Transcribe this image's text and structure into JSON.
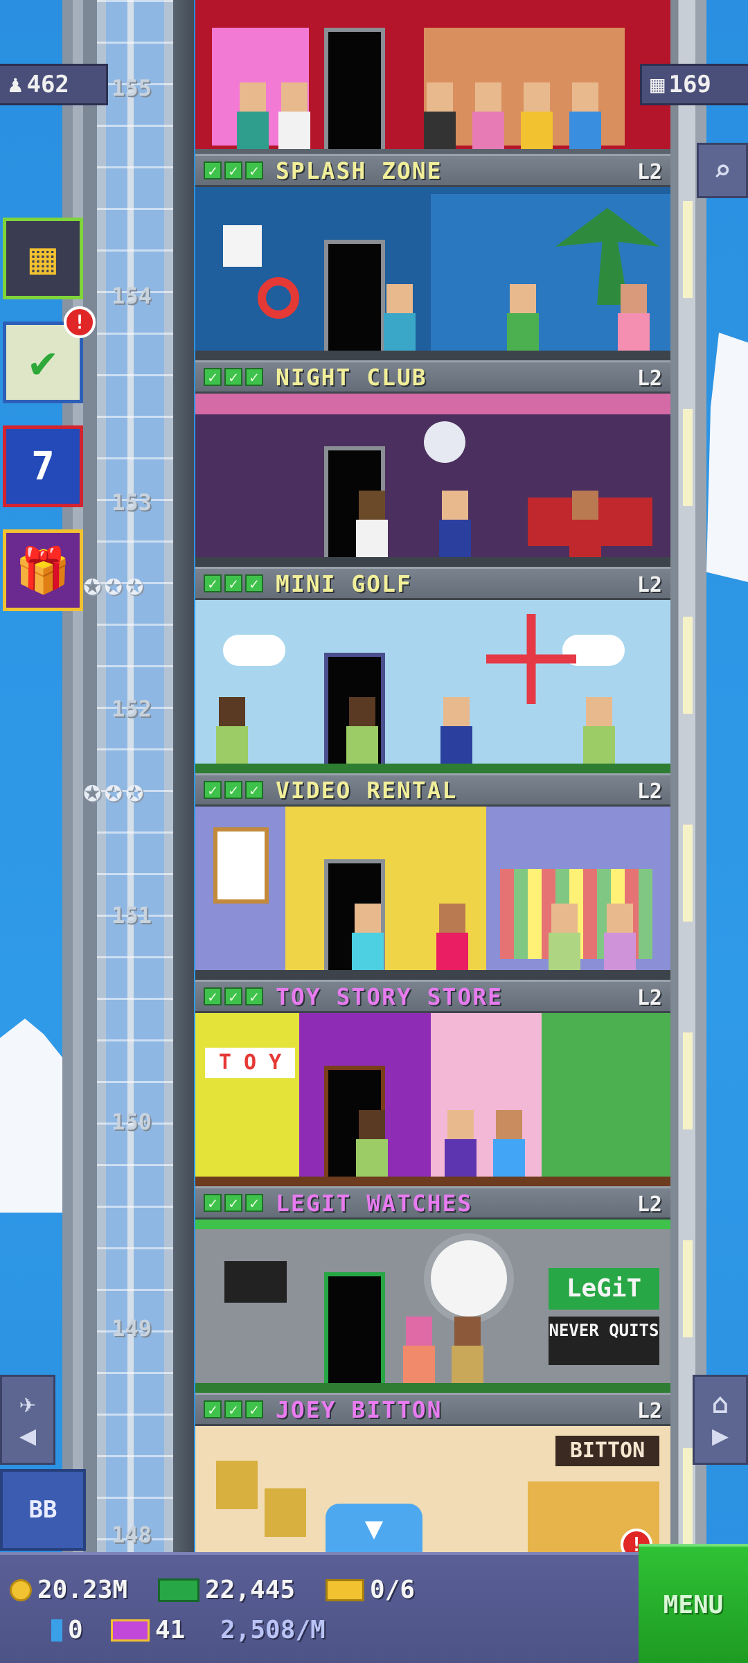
{
  "hud": {
    "population": "462",
    "floors_count": "169",
    "bb_label": "BB"
  },
  "floors": [
    {
      "number": "155",
      "name": "",
      "level": "",
      "theme": "#c83a56"
    },
    {
      "number": "154",
      "name": "SPLASH ZONE",
      "level": "L2",
      "name_color": "#f2ef9a",
      "theme": "#1f5f9e"
    },
    {
      "number": "153",
      "name": "NIGHT CLUB",
      "level": "L2",
      "name_color": "#f2ef9a",
      "theme": "#4b2f5e"
    },
    {
      "number": "152",
      "name": "MINI GOLF",
      "level": "L2",
      "name_color": "#f2ef9a",
      "theme": "#a9d6ee"
    },
    {
      "number": "151",
      "name": "VIDEO RENTAL",
      "level": "L2",
      "name_color": "#f2ef9a",
      "theme": "#f0d447"
    },
    {
      "number": "150",
      "name": "TOY STORY STORE",
      "level": "L2",
      "name_color": "#e77bef",
      "theme": "#8f2cb5"
    },
    {
      "number": "149",
      "name": "LEGIT WATCHES",
      "level": "L2",
      "name_color": "#e77bef",
      "theme": "#8d9298"
    },
    {
      "number": "148",
      "name": "JOEY BITTON",
      "level": "L2",
      "name_color": "#e77bef",
      "theme": "#f1dcb5"
    }
  ],
  "signs": {
    "legit": "LeGiT",
    "never_quits": "NEVER QUITS",
    "bitton": "BITTON",
    "toy": "T O Y"
  },
  "status": {
    "coins": "20.23M",
    "bux": "22,445",
    "tickets": "0/6",
    "elevator_items": "0",
    "vip": "41",
    "rate": "2,508/M"
  },
  "menu_label": "MENU",
  "badges": {
    "missions": "!",
    "bottom": "!"
  },
  "icons": {
    "person": "person-icon",
    "floors": "floors-icon",
    "search": "magnifier-icon",
    "calendar": "calendar-icon",
    "gift": "gift-icon"
  }
}
